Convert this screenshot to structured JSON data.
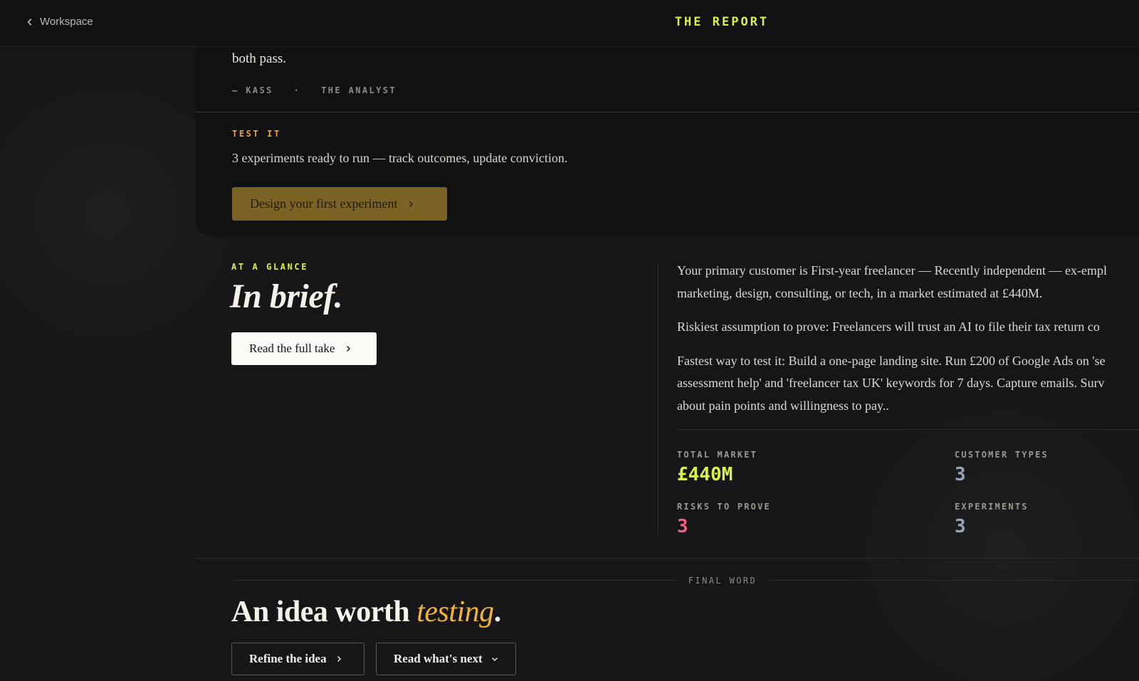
{
  "nav": {
    "back_label": "Workspace",
    "brand": "THE REPORT"
  },
  "quote": {
    "text_tail": "both pass.",
    "author": "— KASS",
    "separator": "·",
    "role": "THE ANALYST"
  },
  "test_it": {
    "label": "TEST IT",
    "description": "3 experiments ready to run — track outcomes, update conviction.",
    "button_label": "Design your first experiment"
  },
  "glance": {
    "label": "AT A GLANCE",
    "title": "In brief.",
    "button_label": "Read the full take",
    "summary": [
      "Your primary customer is First-year freelancer — Recently independent — ex-empl",
      "marketing, design, consulting, or tech, in a market estimated at £440M.",
      "Riskiest assumption to prove: Freelancers will trust an AI to file their tax return co",
      "Fastest way to test it: Build a one-page landing site. Run £200 of Google Ads on 'se",
      "assessment help' and 'freelancer tax UK' keywords for 7 days. Capture emails. Surv",
      "about pain points and willingness to pay.."
    ],
    "stats": [
      {
        "label": "TOTAL MARKET",
        "value": "£440M",
        "color": "#d9f24a"
      },
      {
        "label": "CUSTOMER TYPES",
        "value": "3",
        "color": "#9aa3b8"
      },
      {
        "label": "RISKS TO PROVE",
        "value": "3",
        "color": "#f0607a"
      },
      {
        "label": "EXPERIMENTS",
        "value": "3",
        "color": "#9aa3b8"
      }
    ]
  },
  "final_word": {
    "label": "FINAL WORD",
    "title_start": "An idea worth ",
    "title_highlight": "testing",
    "title_end": ".",
    "refine_label": "Refine the idea",
    "next_label": "Read what's next"
  },
  "icons": {
    "back": "chevron-left-icon",
    "forward": "chevron-right-icon",
    "expand": "chevron-down-icon"
  }
}
